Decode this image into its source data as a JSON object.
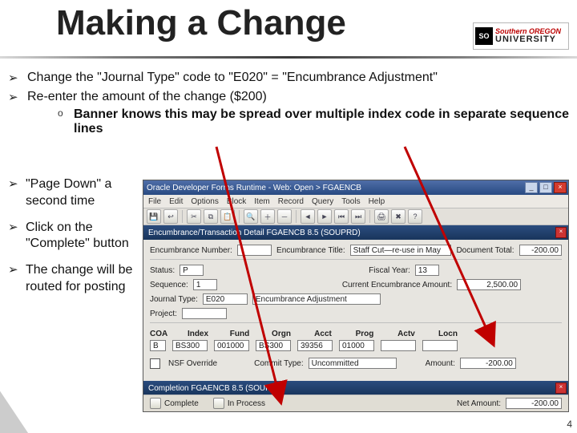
{
  "title": "Making a Change",
  "logo": {
    "tag": "SO",
    "top": "Southern OREGON",
    "bottom": "UNIVERSITY"
  },
  "bullets": {
    "b1": "Change the \"Journal Type\" code to \"E020\" = \"Encumbrance Adjustment\"",
    "b2": "Re-enter the amount of the change ($200)",
    "b2_sub": "Banner knows this may be spread over multiple index code in separate sequence lines",
    "b3": "\"Page Down\" a second time",
    "b4": "Click on the \"Complete\" button",
    "b5": "The change will be routed for posting"
  },
  "app": {
    "window_title": "Oracle Developer Forms Runtime - Web: Open > FGAENCB",
    "menu": [
      "File",
      "Edit",
      "Options",
      "Block",
      "Item",
      "Record",
      "Query",
      "Tools",
      "Help"
    ],
    "form_header": "Encumbrance/Transaction Detail  FGAENCB  8.5  (SOUPRD)",
    "row1": {
      "enc_num_lbl": "Encumbrance Number:",
      "enc_title_lbl": "Encumbrance Title:",
      "enc_title_val": "Staff Cut—re-use in May",
      "doc_total_lbl": "Document Total:",
      "doc_total_val": "-200.00"
    },
    "status": {
      "lbl": "Status:",
      "val": "P",
      "fy_lbl": "Fiscal Year:",
      "fy_val": "13"
    },
    "seq": {
      "lbl": "Sequence:",
      "val": "1",
      "cur_lbl": "Current Encumbrance Amount:",
      "cur_val": "2,500.00"
    },
    "jtype": {
      "lbl": "Journal Type:",
      "val": "E020",
      "desc": "Encumbrance Adjustment"
    },
    "proj": {
      "lbl": "Project:"
    },
    "coa": {
      "coa_lbl": "COA",
      "headers": [
        "Index",
        "Fund",
        "Orgn",
        "Acct",
        "Prog",
        "Actv",
        "Locn"
      ],
      "coa_val": "B",
      "vals": {
        "Index": "BS300",
        "Fund": "001000",
        "Orgn": "BS300",
        "Acct": "39356",
        "Prog": "01000",
        "Actv": "",
        "Locn": ""
      }
    },
    "nsf": {
      "lbl": "NSF Override",
      "commit_lbl": "Commit Type:",
      "commit_val": "Uncommitted",
      "amt_lbl": "Amount:",
      "amt_val": "-200.00"
    },
    "comp_header": "Completion  FGAENCB  8.5  (SOUPRD)",
    "bottom": {
      "complete": "Complete",
      "inproc": "In Process",
      "net_lbl": "Net Amount:",
      "net_val": "-200.00"
    }
  },
  "slide_number": "4"
}
